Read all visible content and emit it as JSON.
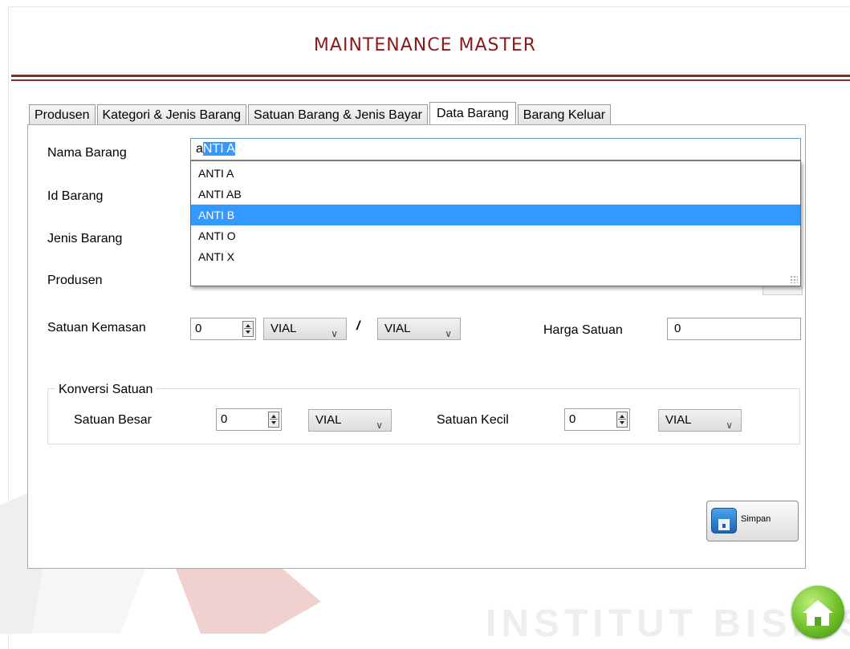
{
  "title": "MAINTENANCE MASTER",
  "tabs": [
    {
      "label": "Produsen"
    },
    {
      "label": "Kategori & Jenis Barang"
    },
    {
      "label": "Satuan Barang & Jenis Bayar"
    },
    {
      "label": "Data Barang",
      "active": true
    },
    {
      "label": "Barang Keluar"
    }
  ],
  "form": {
    "nama_barang_label": "Nama Barang",
    "nama_barang_typed": "a",
    "nama_barang_autocomplete": "NTI A",
    "id_barang_label": "Id Barang",
    "jenis_barang_label": "Jenis Barang",
    "produsen_label": "Produsen",
    "satuan_kemasan_label": "Satuan Kemasan",
    "satuan_kemasan_value": "0",
    "kemasan_unit_1": "VIAL",
    "separator": "/",
    "kemasan_unit_2": "VIAL",
    "harga_satuan_label": "Harga Satuan",
    "harga_satuan_value": "0"
  },
  "autocomplete": {
    "items": [
      "ANTI A",
      "ANTI AB",
      "ANTI B",
      "ANTI O",
      "ANTI X"
    ],
    "highlighted": "ANTI B"
  },
  "konversi": {
    "title": "Konversi Satuan",
    "satuan_besar_label": "Satuan Besar",
    "satuan_besar_value": "0",
    "satuan_besar_unit": "VIAL",
    "satuan_kecil_label": "Satuan Kecil",
    "satuan_kecil_value": "0",
    "satuan_kecil_unit": "VIAL"
  },
  "actions": {
    "save_label": "Simpan"
  },
  "watermark": {
    "text": "INSTITUT BISNIS",
    "colors": [
      "#e8e8e8",
      "#f3d6d6"
    ]
  },
  "colors": {
    "title": "#8a1a1a",
    "rule": "#8a2a2a",
    "selection": "#3399ff",
    "home_button": "#6fbf2a"
  },
  "icons": {
    "save": "save-floppy-icon",
    "home": "home-icon",
    "spinner": "spinner-arrows-icon",
    "combo": "chevron-down-icon"
  }
}
